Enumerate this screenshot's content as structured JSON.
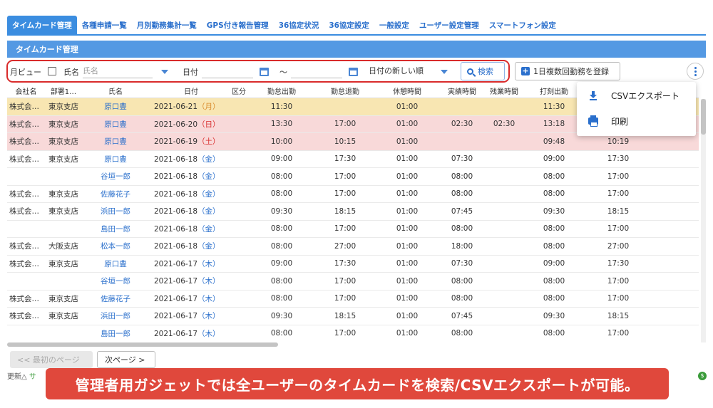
{
  "tabs": [
    {
      "label": "タイムカード管理",
      "active": true
    },
    {
      "label": "各種申請一覧"
    },
    {
      "label": "月別勤務集計一覧"
    },
    {
      "label": "GPS付き報告管理"
    },
    {
      "label": "36協定状況"
    },
    {
      "label": "36協定設定"
    },
    {
      "label": "一般設定"
    },
    {
      "label": "ユーザー設定管理"
    },
    {
      "label": "スマートフォン設定"
    }
  ],
  "panel_title": "タイムカード管理",
  "toolbar": {
    "month_view_label": "月ビュー",
    "name_label": "氏名",
    "name_placeholder": "氏名",
    "date_label": "日付",
    "range_sep": "～",
    "sort_value": "日付の新しい順",
    "search_label": "検索",
    "register_label": "1日複数回勤務を登録"
  },
  "columns": [
    "会社名",
    "部署1…",
    "氏名",
    "日付",
    "区分",
    "勤怠出勤",
    "勤怠退勤",
    "休憩時間",
    "実績時間",
    "残業時間",
    "打刻出勤",
    "",
    ""
  ],
  "rows": [
    {
      "type": "hol",
      "company": "株式会…",
      "dept": "東京支店",
      "name": "原口豊",
      "date": "2021-06-21",
      "dow": "月",
      "kubun": "",
      "in": "11:30",
      "out": "",
      "break": "01:00",
      "actual": "",
      "overtime": "",
      "punch_in": "11:30",
      "punch_out": ""
    },
    {
      "type": "sun",
      "company": "株式会…",
      "dept": "東京支店",
      "name": "原口豊",
      "date": "2021-06-20",
      "dow": "日",
      "kubun": "",
      "in": "13:30",
      "out": "17:00",
      "break": "01:00",
      "actual": "02:30",
      "overtime": "02:30",
      "punch_in": "13:18",
      "punch_out": ""
    },
    {
      "type": "sat",
      "company": "株式会…",
      "dept": "東京支店",
      "name": "原口豊",
      "date": "2021-06-19",
      "dow": "土",
      "kubun": "",
      "in": "10:00",
      "out": "10:15",
      "break": "01:00",
      "actual": "",
      "overtime": "",
      "punch_in": "09:48",
      "punch_out": "10:19"
    },
    {
      "type": "",
      "company": "株式会…",
      "dept": "東京支店",
      "name": "原口豊",
      "date": "2021-06-18",
      "dow": "金",
      "kubun": "",
      "in": "09:00",
      "out": "17:30",
      "break": "01:00",
      "actual": "07:30",
      "overtime": "",
      "punch_in": "09:00",
      "punch_out": "17:30"
    },
    {
      "type": "",
      "company": "",
      "dept": "",
      "name": "谷垣一郎",
      "date": "2021-06-18",
      "dow": "金",
      "kubun": "",
      "in": "08:00",
      "out": "17:00",
      "break": "01:00",
      "actual": "08:00",
      "overtime": "",
      "punch_in": "08:00",
      "punch_out": "17:00"
    },
    {
      "type": "",
      "company": "株式会…",
      "dept": "東京支店",
      "name": "佐藤花子",
      "date": "2021-06-18",
      "dow": "金",
      "kubun": "",
      "in": "08:00",
      "out": "17:00",
      "break": "01:00",
      "actual": "08:00",
      "overtime": "",
      "punch_in": "08:00",
      "punch_out": "17:00"
    },
    {
      "type": "",
      "company": "株式会…",
      "dept": "東京支店",
      "name": "浜田一郎",
      "date": "2021-06-18",
      "dow": "金",
      "kubun": "",
      "in": "09:30",
      "out": "18:15",
      "break": "01:00",
      "actual": "07:45",
      "overtime": "",
      "punch_in": "09:30",
      "punch_out": "18:15"
    },
    {
      "type": "",
      "company": "",
      "dept": "",
      "name": "島田一郎",
      "date": "2021-06-18",
      "dow": "金",
      "kubun": "",
      "in": "08:00",
      "out": "17:00",
      "break": "01:00",
      "actual": "08:00",
      "overtime": "",
      "punch_in": "08:00",
      "punch_out": "17:00"
    },
    {
      "type": "",
      "company": "株式会…",
      "dept": "大阪支店",
      "name": "松本一郎",
      "date": "2021-06-18",
      "dow": "金",
      "kubun": "",
      "in": "08:00",
      "out": "27:00",
      "break": "01:00",
      "actual": "18:00",
      "overtime": "",
      "punch_in": "08:00",
      "punch_out": "27:00"
    },
    {
      "type": "",
      "company": "株式会…",
      "dept": "東京支店",
      "name": "原口豊",
      "date": "2021-06-17",
      "dow": "木",
      "kubun": "",
      "in": "09:00",
      "out": "17:30",
      "break": "01:00",
      "actual": "07:30",
      "overtime": "",
      "punch_in": "09:00",
      "punch_out": "17:30"
    },
    {
      "type": "",
      "company": "",
      "dept": "",
      "name": "谷垣一郎",
      "date": "2021-06-17",
      "dow": "木",
      "kubun": "",
      "in": "08:00",
      "out": "17:00",
      "break": "01:00",
      "actual": "08:00",
      "overtime": "",
      "punch_in": "08:00",
      "punch_out": "17:00"
    },
    {
      "type": "",
      "company": "株式会…",
      "dept": "東京支店",
      "name": "佐藤花子",
      "date": "2021-06-17",
      "dow": "木",
      "kubun": "",
      "in": "08:00",
      "out": "17:00",
      "break": "01:00",
      "actual": "08:00",
      "overtime": "",
      "punch_in": "08:00",
      "punch_out": "17:00"
    },
    {
      "type": "",
      "company": "株式会…",
      "dept": "東京支店",
      "name": "浜田一郎",
      "date": "2021-06-17",
      "dow": "木",
      "kubun": "",
      "in": "09:30",
      "out": "18:15",
      "break": "01:00",
      "actual": "07:45",
      "overtime": "",
      "punch_in": "09:30",
      "punch_out": "18:15"
    },
    {
      "type": "",
      "company": "",
      "dept": "",
      "name": "島田一郎",
      "date": "2021-06-17",
      "dow": "木",
      "kubun": "",
      "in": "08:00",
      "out": "17:00",
      "break": "01:00",
      "actual": "08:00",
      "overtime": "",
      "punch_in": "08:00",
      "punch_out": "17:00"
    }
  ],
  "pager": {
    "prev_label": "<< 最初のページ",
    "next_label": "次ページ >"
  },
  "footer": {
    "updated_label": "更新△",
    "green_label": "サ"
  },
  "menu": {
    "csv_label": "CSVエクスポート",
    "print_label": "印刷"
  },
  "banner": "管理者用ガジェットでは全ユーザーのタイムカードを検索/CSVエクスポートが可能。",
  "colors": {
    "accent": "#3b8de0",
    "highlight_box": "#d92b2b",
    "banner": "#e0483c",
    "holiday_row": "#f8e6b2",
    "weekend_row": "#f8d9d9"
  }
}
